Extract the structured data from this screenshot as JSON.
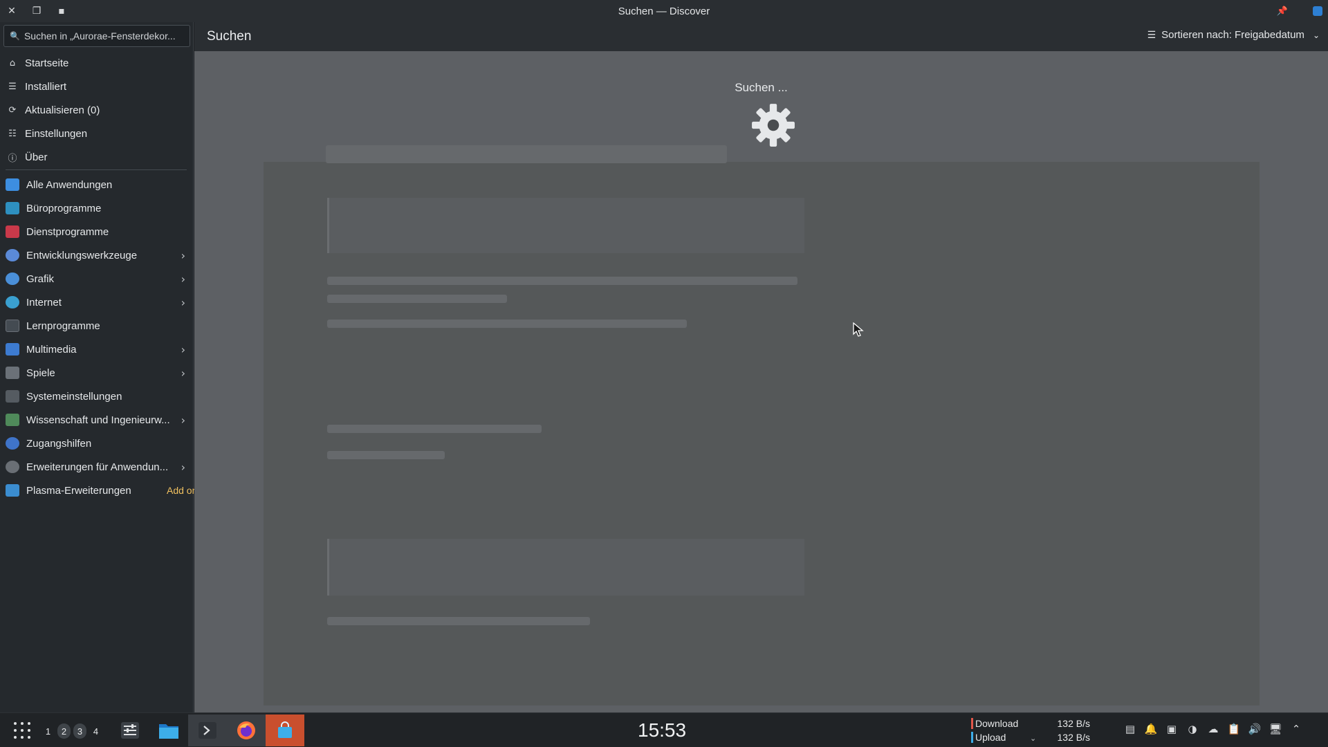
{
  "window": {
    "title": "Suchen — Discover"
  },
  "sidebar": {
    "search_placeholder": "Suchen in „Aurorae-Fensterdekor...",
    "nav": [
      {
        "label": "Startseite",
        "icon": "home-icon"
      },
      {
        "label": "Installiert",
        "icon": "installed-list-icon"
      },
      {
        "label": "Aktualisieren (0)",
        "icon": "update-icon"
      },
      {
        "label": "Einstellungen",
        "icon": "settings-sliders-icon"
      },
      {
        "label": "Über",
        "icon": "info-icon"
      }
    ],
    "categories": [
      {
        "label": "Alle Anwendungen",
        "color": "#3d8ee0",
        "has_children": false
      },
      {
        "label": "Büroprogramme",
        "color": "#2e90c0",
        "has_children": false
      },
      {
        "label": "Dienstprogramme",
        "color": "#c9394a",
        "has_children": false
      },
      {
        "label": "Entwicklungswerkzeuge",
        "color": "#5b8ad8",
        "has_children": true
      },
      {
        "label": "Grafik",
        "color": "#4a8fd8",
        "has_children": true
      },
      {
        "label": "Internet",
        "color": "#3aa0d0",
        "has_children": true
      },
      {
        "label": "Lernprogramme",
        "color": "#444b52",
        "has_children": false
      },
      {
        "label": "Multimedia",
        "color": "#3d7bd0",
        "has_children": true
      },
      {
        "label": "Spiele",
        "color": "#6b7178",
        "has_children": true
      },
      {
        "label": "Systemeinstellungen",
        "color": "#555b61",
        "has_children": false
      },
      {
        "label": "Wissenschaft und Ingenieurw...",
        "color": "#4f8a5a",
        "has_children": true
      },
      {
        "label": "Zugangshilfen",
        "color": "#3f74c9",
        "has_children": false
      },
      {
        "label": "Erweiterungen für Anwendun...",
        "color": "#6a6f75",
        "has_children": true
      },
      {
        "label": "Plasma-Erweiterungen",
        "color": "#3b8dd0",
        "has_children": false,
        "badge": "Add ons"
      }
    ]
  },
  "main": {
    "title": "Suchen",
    "sort_label": "Sortieren nach: Freigabedatum",
    "loading_text": "Suchen ..."
  },
  "taskbar": {
    "pager": [
      "1",
      "2",
      "3",
      "4"
    ],
    "clock": "15:53",
    "network": {
      "download_label": "Download",
      "download_value": "132 B/s",
      "upload_label": "Upload",
      "upload_value": "132 B/s"
    }
  }
}
